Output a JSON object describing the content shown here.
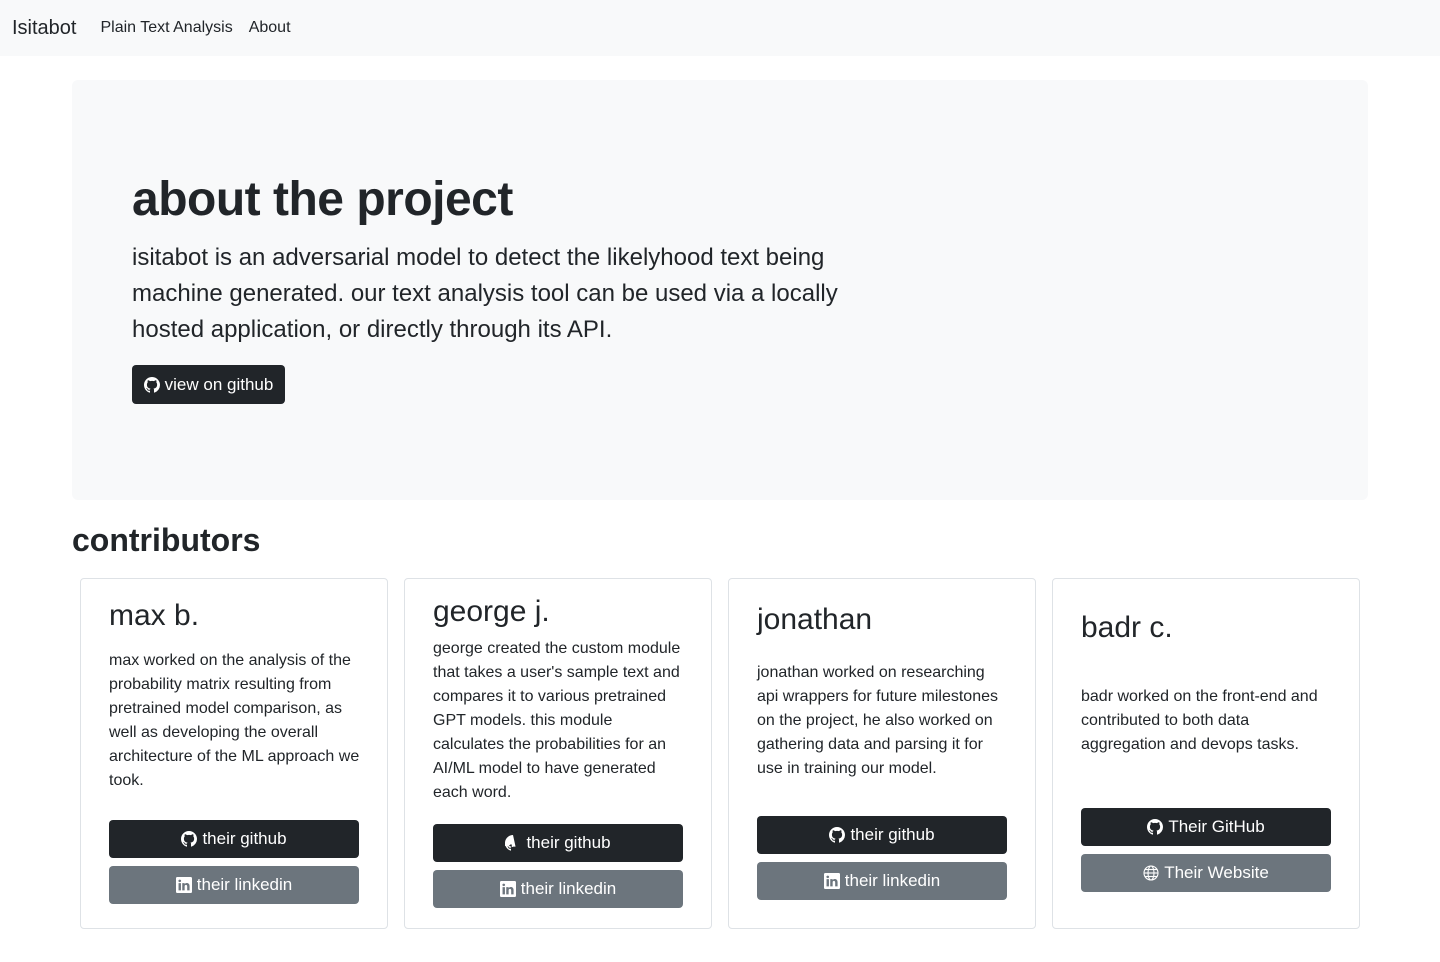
{
  "nav": {
    "brand": "Isitabot",
    "links": [
      "Plain Text Analysis",
      "About"
    ]
  },
  "hero": {
    "title": "about the project",
    "lead": "isitabot is an adversarial model to detect the likelyhood text being machine generated. our text analysis tool can be used via a locally hosted application, or directly through its API.",
    "button_label": "view on github"
  },
  "contributors": {
    "heading": "contributors",
    "cards": [
      {
        "name": "max b.",
        "description": "max worked on the analysis of the probability matrix resulting from pretrained model comparison, as well as developing the overall architecture of the ML approach we took.",
        "primary_label": "their github",
        "secondary_label": "their linkedin"
      },
      {
        "name": "george j.",
        "description": "george created the custom module that takes a user's sample text and compares it to various pretrained GPT models. this module calculates the probabilities for an AI/ML model to have generated each word.",
        "primary_label": "their github",
        "secondary_label": "their linkedin"
      },
      {
        "name": "jonathan",
        "description": "jonathan worked on researching api wrappers for future milestones on the project, he also worked on gathering data and parsing it for use in training our model.",
        "primary_label": "their github",
        "secondary_label": "their linkedin"
      },
      {
        "name": "badr c.",
        "description": "badr worked on the front-end and contributed to both data aggregation and devops tasks.",
        "primary_label": "Their GitHub",
        "secondary_label": "Their Website"
      }
    ]
  },
  "icons": {
    "github": "github-icon",
    "linkedin": "linkedin-icon",
    "globe": "globe-icon"
  },
  "colors": {
    "navbar_bg": "#f8f9fa",
    "dark_button": "#212529",
    "gray_button": "#6c757d"
  }
}
